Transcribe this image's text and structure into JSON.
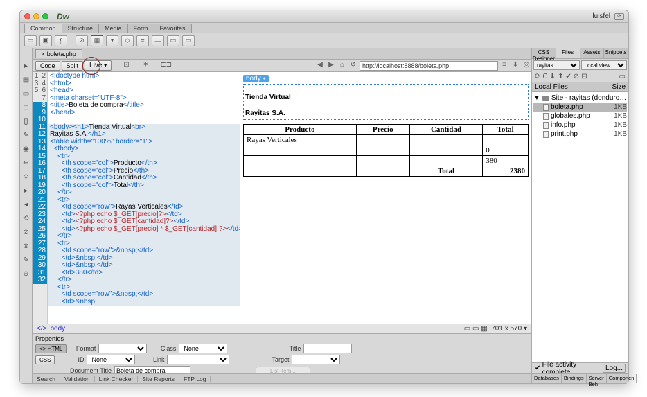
{
  "titlebar": {
    "app": "Dw",
    "user": "luisfel"
  },
  "menubar": [
    "Common",
    "Structure",
    "Media",
    "Form",
    "Favorites"
  ],
  "doc_tab": "× boleta.php",
  "view_buttons": [
    "Code",
    "Split",
    "Live"
  ],
  "url": "http://localhost:8888/boleta.php",
  "gutter": {
    "lines": [
      "1",
      "2",
      "3",
      "4",
      "5",
      "6",
      "7",
      "8",
      "9",
      "10",
      "11",
      "12",
      "13",
      "14",
      "15",
      "16",
      "17",
      "18",
      "19",
      "20",
      "21",
      "22",
      "23",
      "24",
      "25",
      "26",
      "27",
      "28",
      "29",
      "30",
      "31",
      "32"
    ]
  },
  "code": {
    "l1": "<!doctype html>",
    "l2": "<html>",
    "l3": "<head>",
    "l4": "<meta charset=\"UTF-8\">",
    "l5a": "<title>",
    "l5b": "Boleta de compra",
    "l5c": "</title>",
    "l6": "</head>",
    "l8a": "<body><h1>",
    "l8b": "Tienda Virtual",
    "l8c": "<br>",
    "l9a": "Rayitas S.A.",
    "l9b": "</h1>",
    "l10": "<table width=\"100%\" border=\"1\">",
    "l11": "  <tbody>",
    "l12": "    <tr>",
    "l13a": "      <th scope=\"col\">",
    "l13b": "Producto",
    "l13c": "</th>",
    "l14a": "      <th scope=\"col\">",
    "l14b": "Precio",
    "l14c": "</th>",
    "l15a": "      <th scope=\"col\">",
    "l15b": "Cantidad",
    "l15c": "</th>",
    "l16a": "      <th scope=\"col\">",
    "l16b": "Total",
    "l16c": "</th>",
    "l17": "    </tr>",
    "l18": "    <tr>",
    "l19a": "      <td scope=\"row\">",
    "l19b": "Rayas Verticales",
    "l19c": "</td>",
    "l20a": "      <td>",
    "l20b": "<?php echo $_GET[precio]?>",
    "l20c": "</td>",
    "l21a": "      <td>",
    "l21b": "<?php echo $_GET[cantidad]?>",
    "l21c": "</td>",
    "l22a": "      <td>",
    "l22b": "<?php echo $_GET[precio] * $_GET[cantidad];?>",
    "l22c": "</td>",
    "l23": "    </tr>",
    "l24": "    <tr>",
    "l25": "      <td scope=\"row\">&nbsp;</td>",
    "l26": "      <td>&nbsp;</td>",
    "l27": "      <td>&nbsp;</td>",
    "l28": "      <td>380</td>",
    "l29": "    </tr>",
    "l30": "    <tr>",
    "l31": "      <td scope=\"row\">&nbsp;</td>",
    "l32": "      <td>&nbsp;"
  },
  "preview": {
    "body_tag": "body",
    "h1_l1": "Tienda Virtual",
    "h1_l2": "Rayitas S.A.",
    "th": [
      "Producto",
      "Precio",
      "Cantidad",
      "Total"
    ],
    "row1": "Rayas Verticales",
    "row3_c0": "0",
    "row3_c3": "380",
    "row4_total_lbl": "Total",
    "row4_total": "2380"
  },
  "tagpath": {
    "p1": "</>",
    "p2": "body",
    "dims": "701 x 570"
  },
  "properties": {
    "title": "Properties",
    "html": "<> HTML",
    "css": "CSS",
    "format_lbl": "Format",
    "format_val": "",
    "class_lbl": "Class",
    "class_val": "None",
    "title_lbl": "Title",
    "id_lbl": "ID",
    "id_val": "None",
    "link_lbl": "Link",
    "target_lbl": "Target",
    "doctitle_lbl": "Document Title",
    "doctitle_val": "Boleta de compra",
    "listitem": "List Item..."
  },
  "footer_tabs": [
    "Search",
    "Validation",
    "Link Checker",
    "Site Reports",
    "FTP Log"
  ],
  "right": {
    "tabs": [
      "CSS Designer",
      "Files",
      "Assets",
      "Snippets"
    ],
    "site_sel": "rayitas",
    "view_sel": "Local view",
    "hd_local": "Local Files",
    "hd_size": "Size",
    "root": "Site - rayitas (donduro:Users:luisf...",
    "files": [
      {
        "n": "boleta.php",
        "s": "1KB"
      },
      {
        "n": "globales.php",
        "s": "1KB"
      },
      {
        "n": "info.php",
        "s": "1KB"
      },
      {
        "n": "print.php",
        "s": "1KB"
      }
    ],
    "activity": "File activity complete.",
    "log": "Log...",
    "bot_tabs": [
      "Databases",
      "Bindings",
      "Server Beh",
      "Componen"
    ]
  }
}
